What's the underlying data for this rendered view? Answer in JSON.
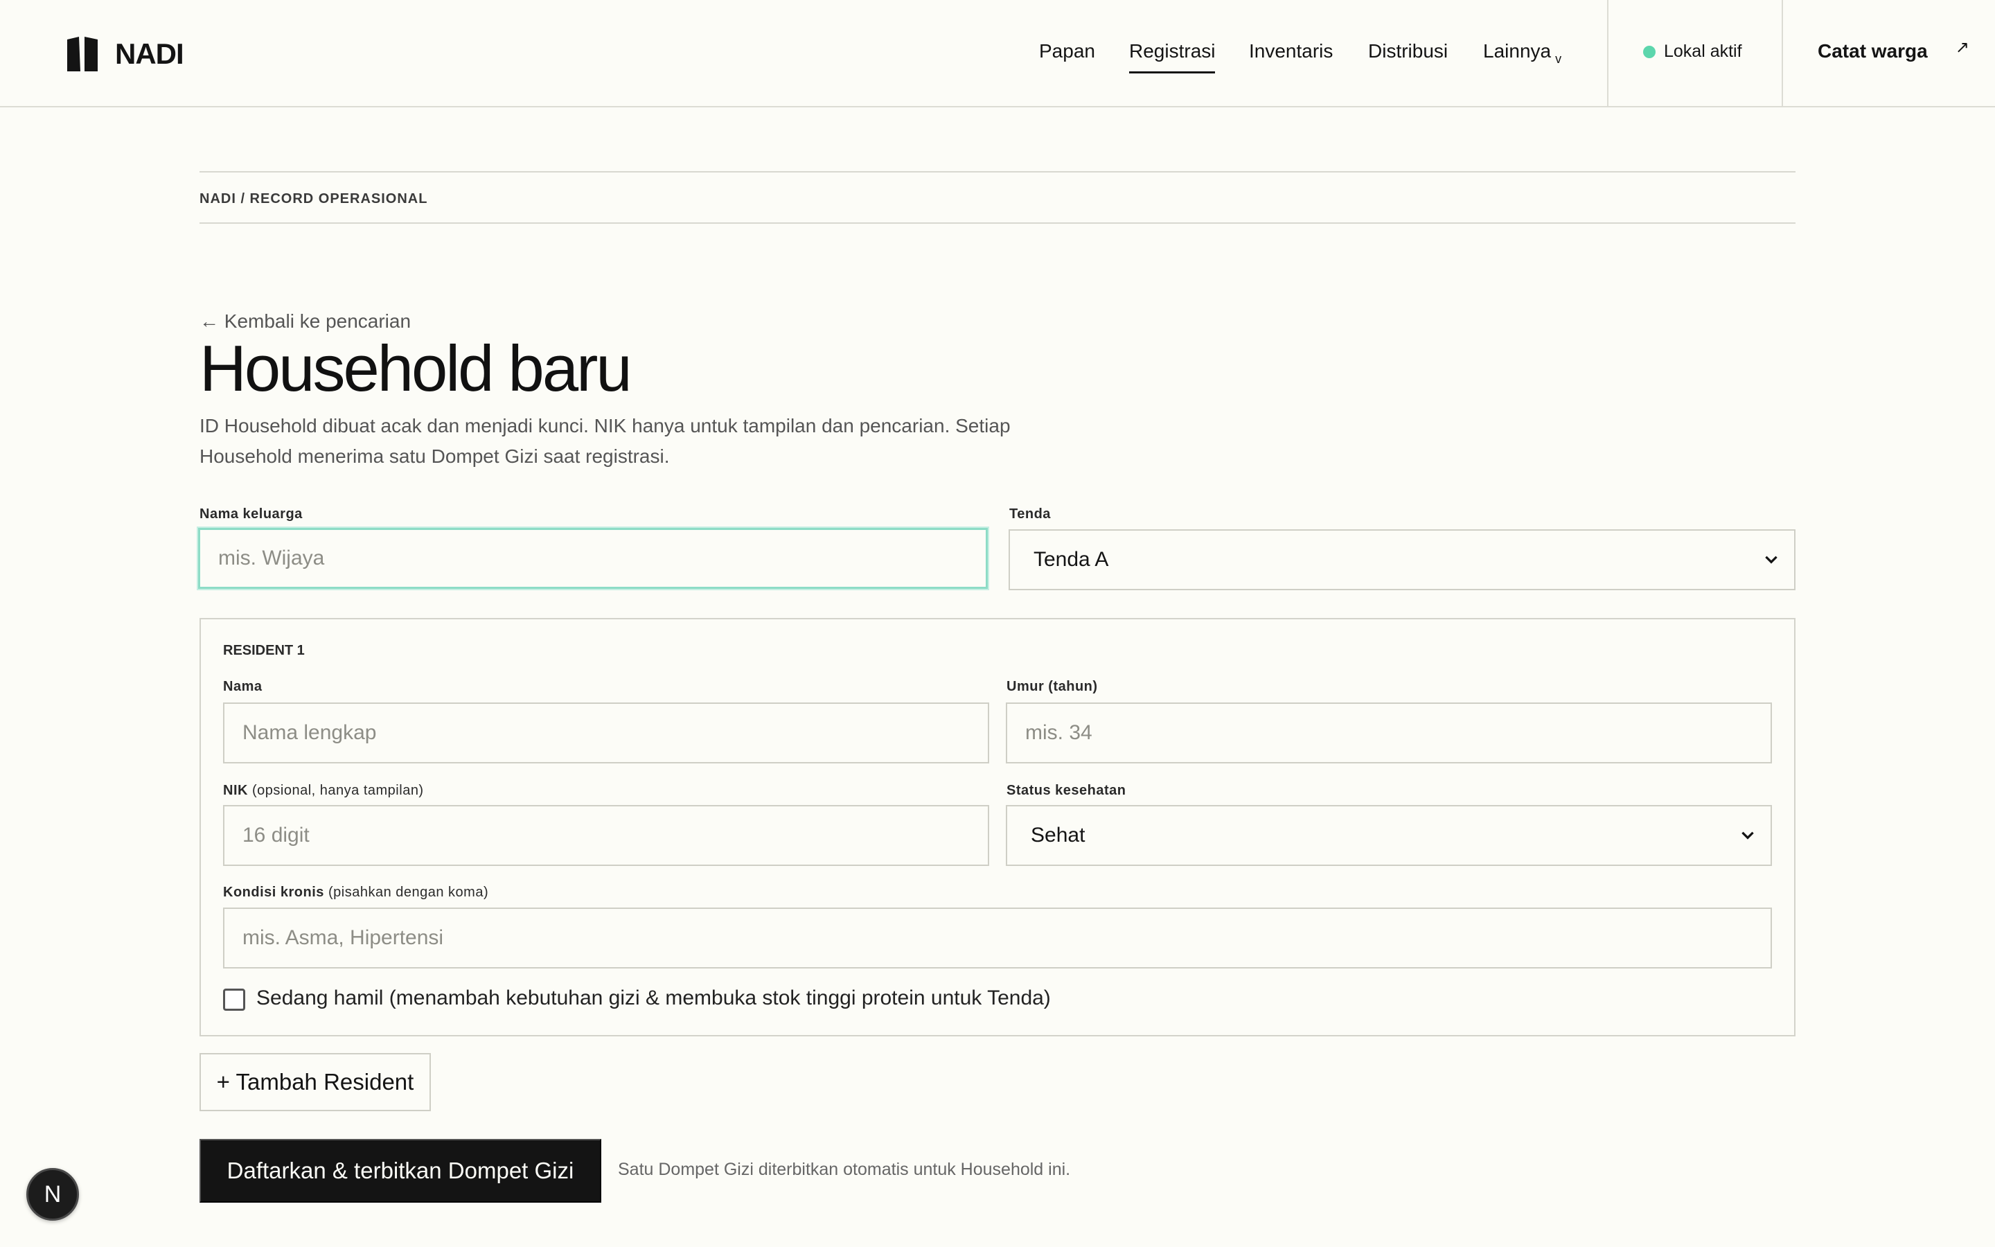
{
  "header": {
    "brand": "NADI",
    "nav": [
      "Papan",
      "Registrasi",
      "Inventaris",
      "Distribusi",
      "Lainnya"
    ],
    "active_nav": "Registrasi",
    "status_text": "Lokal aktif",
    "record_link": "Catat warga",
    "record_arrow": "↗",
    "dropdown_glyph": "v"
  },
  "breadcrumb": "NADI / RECORD OPERASIONAL",
  "page": {
    "back_link": "← Kembali ke pencarian",
    "title": "Household baru",
    "description": "ID Household dibuat acak dan menjadi kunci. NIK hanya untuk tampilan dan pencarian. Setiap Household menerima satu Dompet Gizi saat registrasi."
  },
  "form": {
    "family_label": "Nama keluarga",
    "family_placeholder": "mis. Wijaya",
    "tent_label": "Tenda",
    "tent_value": "Tenda A",
    "resident": {
      "card_title": "RESIDENT 1",
      "name_label": "Nama",
      "name_placeholder": "Nama lengkap",
      "age_label": "Umur (tahun)",
      "age_placeholder": "mis. 34",
      "nik_label_main": "NIK",
      "nik_label_note": "(opsional, hanya tampilan)",
      "nik_placeholder": "16 digit",
      "health_label": "Status kesehatan",
      "health_value": "Sehat",
      "chronic_label_main": "Kondisi kronis",
      "chronic_label_note": "(pisahkan dengan koma)",
      "chronic_placeholder": "mis. Asma, Hipertensi",
      "pregnant_label": "Sedang hamil (menambah kebutuhan gizi & membuka stok tinggi protein untuk Tenda)"
    },
    "add_resident": "+ Tambah Resident",
    "submit": "Daftarkan & terbitkan Dompet Gizi",
    "submit_note": "Satu Dompet Gizi diterbitkan otomatis untuk Household ini."
  },
  "dev_badge": "N",
  "colors": {
    "background": "#fcfcf7",
    "primary": "#141414",
    "status_dot": "#5cd6ac",
    "focus_ring": "#8ddcc6"
  }
}
